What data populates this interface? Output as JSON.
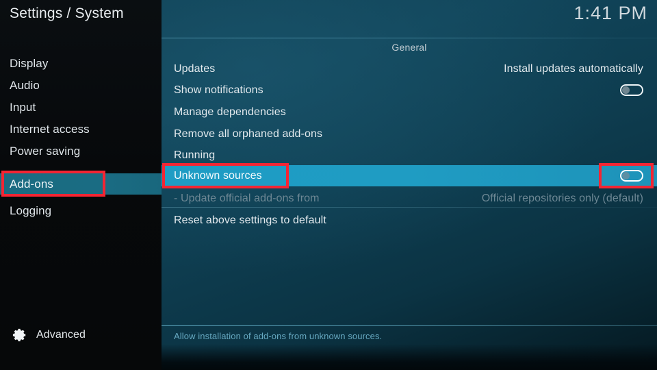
{
  "sidebar": {
    "title": "Settings / System",
    "items": [
      {
        "label": "Display",
        "selected": false
      },
      {
        "label": "Audio",
        "selected": false
      },
      {
        "label": "Input",
        "selected": false
      },
      {
        "label": "Internet access",
        "selected": false
      },
      {
        "label": "Power saving",
        "selected": false
      },
      {
        "label": "Add-ons",
        "selected": true
      },
      {
        "label": "Logging",
        "selected": false
      }
    ],
    "advanced": {
      "label": "Advanced",
      "icon": "gear-icon"
    }
  },
  "header": {
    "clock": "1:41 PM",
    "group_title": "General"
  },
  "settings": {
    "rows": [
      {
        "label": "Updates",
        "value": "Install updates automatically",
        "control": "text",
        "state": "normal"
      },
      {
        "label": "Show notifications",
        "value": "",
        "control": "toggle",
        "toggle_on": false,
        "state": "normal"
      },
      {
        "label": "Manage dependencies",
        "value": "",
        "control": "none",
        "state": "normal"
      },
      {
        "label": "Remove all orphaned add-ons",
        "value": "",
        "control": "none",
        "state": "normal"
      },
      {
        "label": "Running",
        "value": "",
        "control": "none",
        "state": "normal"
      },
      {
        "label": "Unknown sources",
        "value": "",
        "control": "toggle",
        "toggle_on": false,
        "state": "selected"
      },
      {
        "label": "- Update official add-ons from",
        "value": "Official repositories only (default)",
        "control": "text",
        "state": "disabled"
      },
      {
        "label": "Reset above settings to default",
        "value": "",
        "control": "none",
        "state": "normal"
      }
    ]
  },
  "footer": {
    "help_text": "Allow installation of add-ons from unknown sources."
  },
  "annotations": {
    "accent_color": "#f42533",
    "boxes": [
      {
        "name": "addons-sidebar-highlight"
      },
      {
        "name": "unknown-sources-highlight"
      },
      {
        "name": "unknown-sources-toggle-highlight"
      }
    ]
  },
  "colors": {
    "selection_blue": "#1e9cc4",
    "sidebar_selection": "#1b6b81",
    "panel_teal": "#0f4054",
    "annotation_red": "#f42533",
    "help_text_blue": "#66a8c0"
  }
}
